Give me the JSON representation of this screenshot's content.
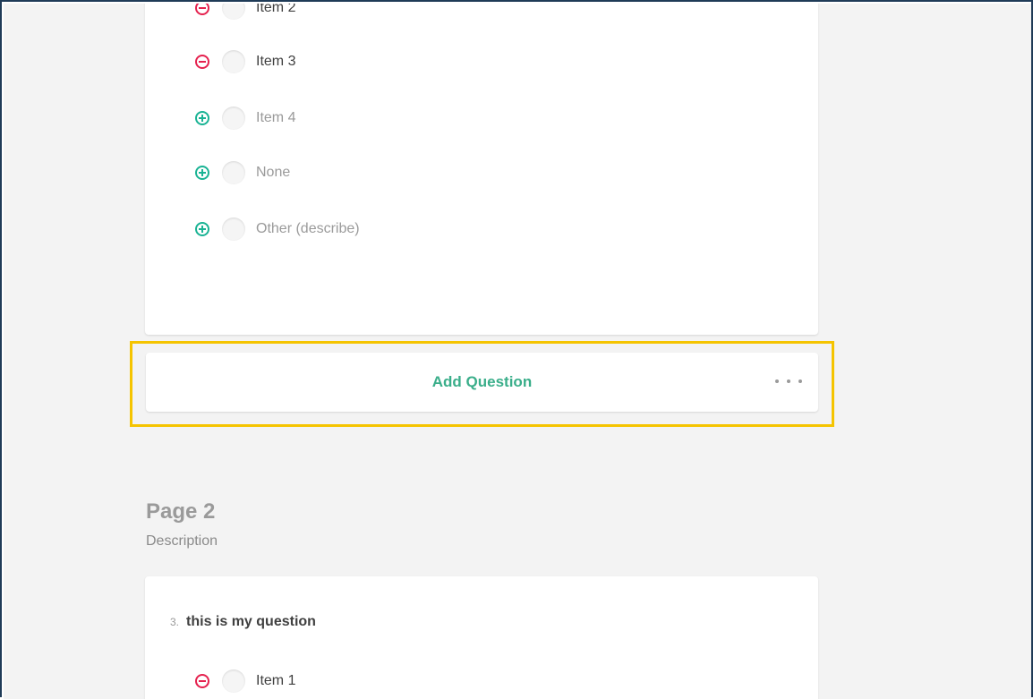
{
  "question_2": {
    "choices": [
      {
        "label": "Item 2",
        "action": "remove",
        "state": "active"
      },
      {
        "label": "Item 3",
        "action": "remove",
        "state": "active"
      },
      {
        "label": "Item 4",
        "action": "add",
        "state": "muted"
      },
      {
        "label": "None",
        "action": "add",
        "state": "muted"
      },
      {
        "label": "Other (describe)",
        "action": "add",
        "state": "muted"
      }
    ]
  },
  "toolbar": {
    "add_question_label": "Add Question",
    "more_icon": "ellipsis-icon"
  },
  "page2": {
    "title": "Page 2",
    "description": "Description"
  },
  "question_3": {
    "number": "3.",
    "title": "this is my question",
    "choices": [
      {
        "label": "Item 1",
        "action": "remove",
        "state": "active"
      }
    ]
  },
  "colors": {
    "remove": "#e5224f",
    "add": "#1ab394",
    "accent_text": "#3aae8a",
    "highlight": "#f5c400",
    "frame": "#1f3b57",
    "background": "#f3f3f3"
  },
  "icons": {
    "remove": "minus-circle-icon",
    "add": "plus-circle-icon"
  }
}
